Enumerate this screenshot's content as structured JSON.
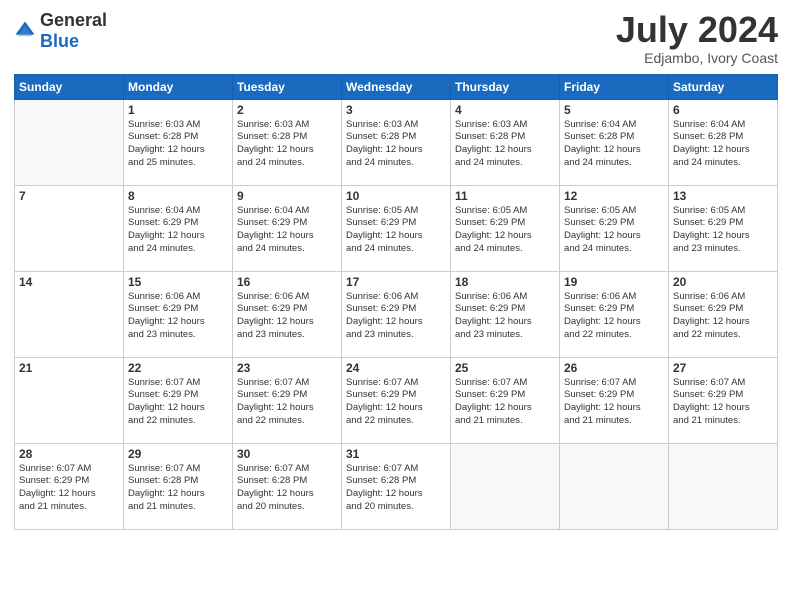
{
  "logo": {
    "general": "General",
    "blue": "Blue"
  },
  "header": {
    "month": "July 2024",
    "location": "Edjambo, Ivory Coast"
  },
  "weekdays": [
    "Sunday",
    "Monday",
    "Tuesday",
    "Wednesday",
    "Thursday",
    "Friday",
    "Saturday"
  ],
  "weeks": [
    [
      {
        "day": "",
        "lines": []
      },
      {
        "day": "1",
        "lines": [
          "Sunrise: 6:03 AM",
          "Sunset: 6:28 PM",
          "Daylight: 12 hours",
          "and 25 minutes."
        ]
      },
      {
        "day": "2",
        "lines": [
          "Sunrise: 6:03 AM",
          "Sunset: 6:28 PM",
          "Daylight: 12 hours",
          "and 24 minutes."
        ]
      },
      {
        "day": "3",
        "lines": [
          "Sunrise: 6:03 AM",
          "Sunset: 6:28 PM",
          "Daylight: 12 hours",
          "and 24 minutes."
        ]
      },
      {
        "day": "4",
        "lines": [
          "Sunrise: 6:03 AM",
          "Sunset: 6:28 PM",
          "Daylight: 12 hours",
          "and 24 minutes."
        ]
      },
      {
        "day": "5",
        "lines": [
          "Sunrise: 6:04 AM",
          "Sunset: 6:28 PM",
          "Daylight: 12 hours",
          "and 24 minutes."
        ]
      },
      {
        "day": "6",
        "lines": [
          "Sunrise: 6:04 AM",
          "Sunset: 6:28 PM",
          "Daylight: 12 hours",
          "and 24 minutes."
        ]
      }
    ],
    [
      {
        "day": "7",
        "lines": []
      },
      {
        "day": "8",
        "lines": [
          "Sunrise: 6:04 AM",
          "Sunset: 6:29 PM",
          "Daylight: 12 hours",
          "and 24 minutes."
        ]
      },
      {
        "day": "9",
        "lines": [
          "Sunrise: 6:04 AM",
          "Sunset: 6:29 PM",
          "Daylight: 12 hours",
          "and 24 minutes."
        ]
      },
      {
        "day": "10",
        "lines": [
          "Sunrise: 6:05 AM",
          "Sunset: 6:29 PM",
          "Daylight: 12 hours",
          "and 24 minutes."
        ]
      },
      {
        "day": "11",
        "lines": [
          "Sunrise: 6:05 AM",
          "Sunset: 6:29 PM",
          "Daylight: 12 hours",
          "and 24 minutes."
        ]
      },
      {
        "day": "12",
        "lines": [
          "Sunrise: 6:05 AM",
          "Sunset: 6:29 PM",
          "Daylight: 12 hours",
          "and 24 minutes."
        ]
      },
      {
        "day": "13",
        "lines": [
          "Sunrise: 6:05 AM",
          "Sunset: 6:29 PM",
          "Daylight: 12 hours",
          "and 23 minutes."
        ]
      }
    ],
    [
      {
        "day": "14",
        "lines": []
      },
      {
        "day": "15",
        "lines": [
          "Sunrise: 6:06 AM",
          "Sunset: 6:29 PM",
          "Daylight: 12 hours",
          "and 23 minutes."
        ]
      },
      {
        "day": "16",
        "lines": [
          "Sunrise: 6:06 AM",
          "Sunset: 6:29 PM",
          "Daylight: 12 hours",
          "and 23 minutes."
        ]
      },
      {
        "day": "17",
        "lines": [
          "Sunrise: 6:06 AM",
          "Sunset: 6:29 PM",
          "Daylight: 12 hours",
          "and 23 minutes."
        ]
      },
      {
        "day": "18",
        "lines": [
          "Sunrise: 6:06 AM",
          "Sunset: 6:29 PM",
          "Daylight: 12 hours",
          "and 23 minutes."
        ]
      },
      {
        "day": "19",
        "lines": [
          "Sunrise: 6:06 AM",
          "Sunset: 6:29 PM",
          "Daylight: 12 hours",
          "and 22 minutes."
        ]
      },
      {
        "day": "20",
        "lines": [
          "Sunrise: 6:06 AM",
          "Sunset: 6:29 PM",
          "Daylight: 12 hours",
          "and 22 minutes."
        ]
      }
    ],
    [
      {
        "day": "21",
        "lines": []
      },
      {
        "day": "22",
        "lines": [
          "Sunrise: 6:07 AM",
          "Sunset: 6:29 PM",
          "Daylight: 12 hours",
          "and 22 minutes."
        ]
      },
      {
        "day": "23",
        "lines": [
          "Sunrise: 6:07 AM",
          "Sunset: 6:29 PM",
          "Daylight: 12 hours",
          "and 22 minutes."
        ]
      },
      {
        "day": "24",
        "lines": [
          "Sunrise: 6:07 AM",
          "Sunset: 6:29 PM",
          "Daylight: 12 hours",
          "and 22 minutes."
        ]
      },
      {
        "day": "25",
        "lines": [
          "Sunrise: 6:07 AM",
          "Sunset: 6:29 PM",
          "Daylight: 12 hours",
          "and 21 minutes."
        ]
      },
      {
        "day": "26",
        "lines": [
          "Sunrise: 6:07 AM",
          "Sunset: 6:29 PM",
          "Daylight: 12 hours",
          "and 21 minutes."
        ]
      },
      {
        "day": "27",
        "lines": [
          "Sunrise: 6:07 AM",
          "Sunset: 6:29 PM",
          "Daylight: 12 hours",
          "and 21 minutes."
        ]
      }
    ],
    [
      {
        "day": "28",
        "lines": [
          "Sunrise: 6:07 AM",
          "Sunset: 6:29 PM",
          "Daylight: 12 hours",
          "and 21 minutes."
        ]
      },
      {
        "day": "29",
        "lines": [
          "Sunrise: 6:07 AM",
          "Sunset: 6:28 PM",
          "Daylight: 12 hours",
          "and 21 minutes."
        ]
      },
      {
        "day": "30",
        "lines": [
          "Sunrise: 6:07 AM",
          "Sunset: 6:28 PM",
          "Daylight: 12 hours",
          "and 20 minutes."
        ]
      },
      {
        "day": "31",
        "lines": [
          "Sunrise: 6:07 AM",
          "Sunset: 6:28 PM",
          "Daylight: 12 hours",
          "and 20 minutes."
        ]
      },
      {
        "day": "",
        "lines": []
      },
      {
        "day": "",
        "lines": []
      },
      {
        "day": "",
        "lines": []
      }
    ]
  ]
}
